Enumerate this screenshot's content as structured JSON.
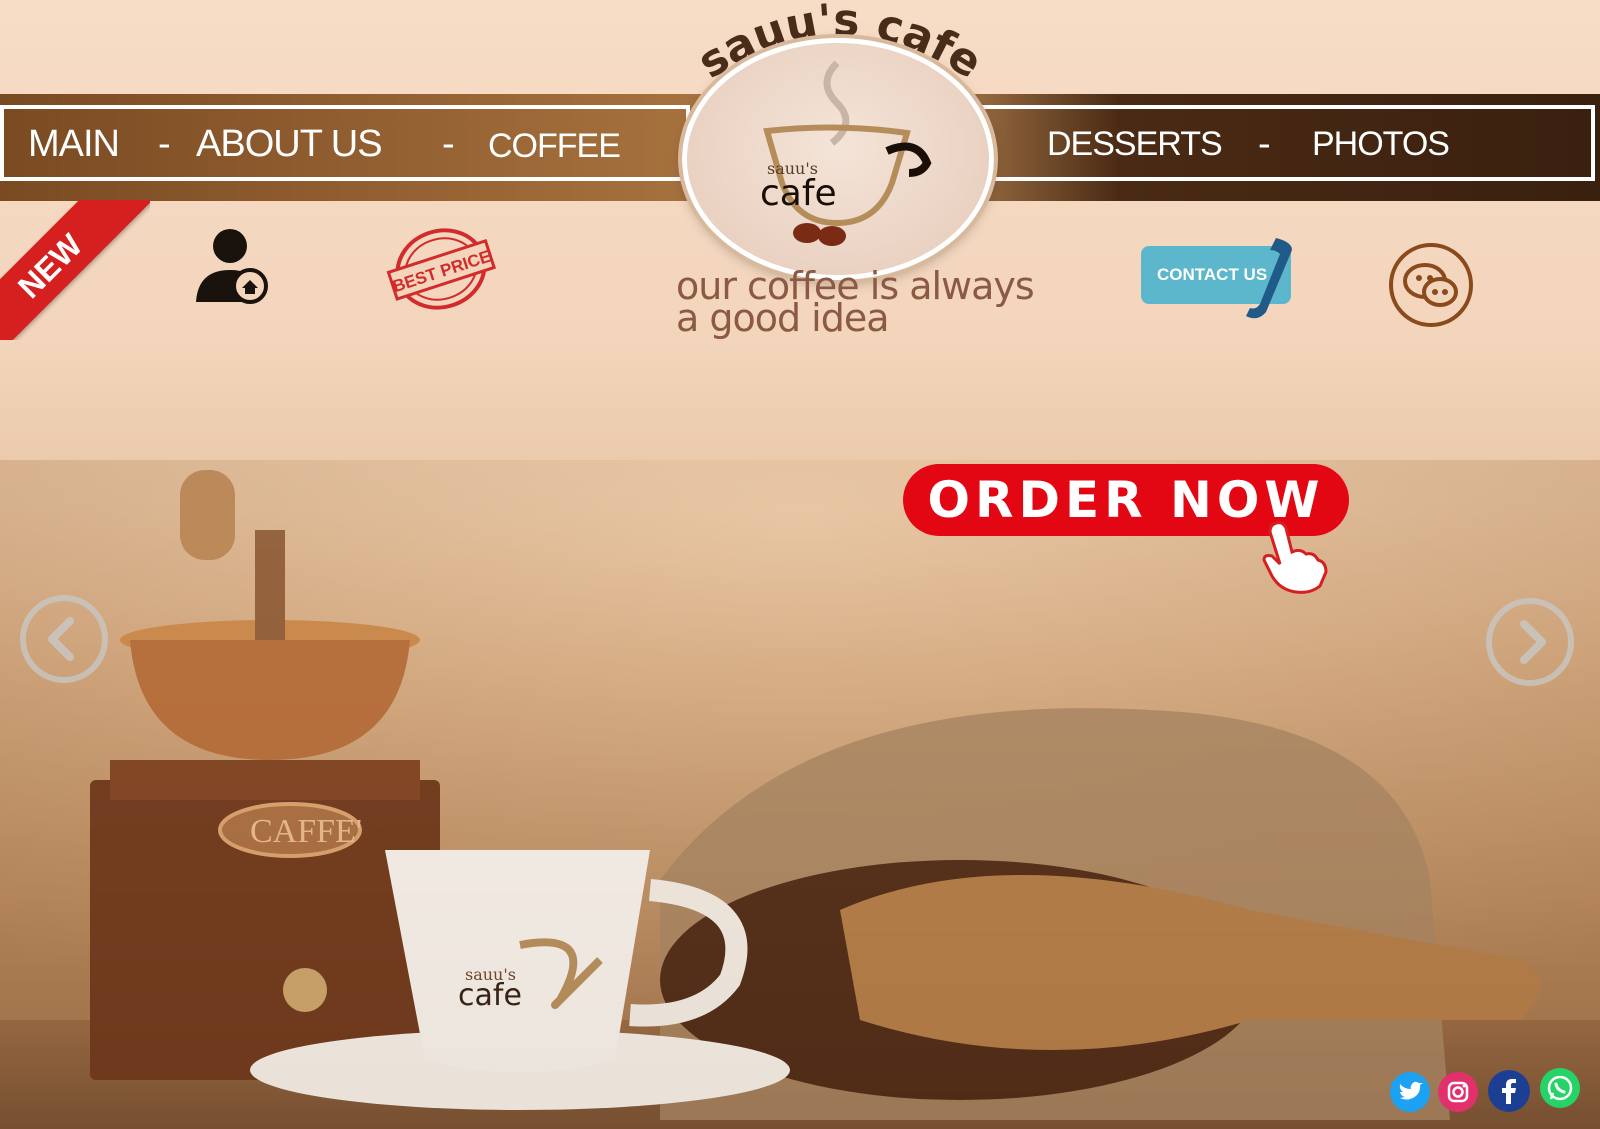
{
  "brand": {
    "name_arc": "sauu's cafe",
    "logo_small": "sauu's",
    "logo_big": "cafe",
    "tagline_line1": "our coffee is always",
    "tagline_line2": "a good idea"
  },
  "nav": {
    "left": [
      "MAIN",
      "ABOUT US",
      "COFFEE"
    ],
    "right": [
      "DESSERTS",
      "PHOTOS"
    ],
    "separator": "-"
  },
  "badges": {
    "new": "NEW",
    "best_price": "BEST PRICE"
  },
  "buttons": {
    "contact": "CONTACT US",
    "order": "ORDER NOW"
  },
  "product": {
    "grinder_label": "CAFFE'",
    "cup_small": "sauu's",
    "cup_big": "cafe"
  },
  "icons": {
    "user_home": "user-home-icon",
    "chat": "chat-icon",
    "phone": "phone-icon",
    "prev": "chevron-left-icon",
    "next": "chevron-right-icon",
    "hand": "pointer-hand-icon"
  },
  "social": [
    {
      "name": "twitter",
      "color": "#1da1f2"
    },
    {
      "name": "instagram",
      "color": "#e1306c"
    },
    {
      "name": "facebook",
      "color": "#1c3f94"
    },
    {
      "name": "whatsapp",
      "color": "#25d366"
    }
  ],
  "colors": {
    "accent_red": "#e30613",
    "nav_dark": "#3a200f",
    "nav_light": "#c8955d",
    "contact": "#5cb7cc"
  }
}
